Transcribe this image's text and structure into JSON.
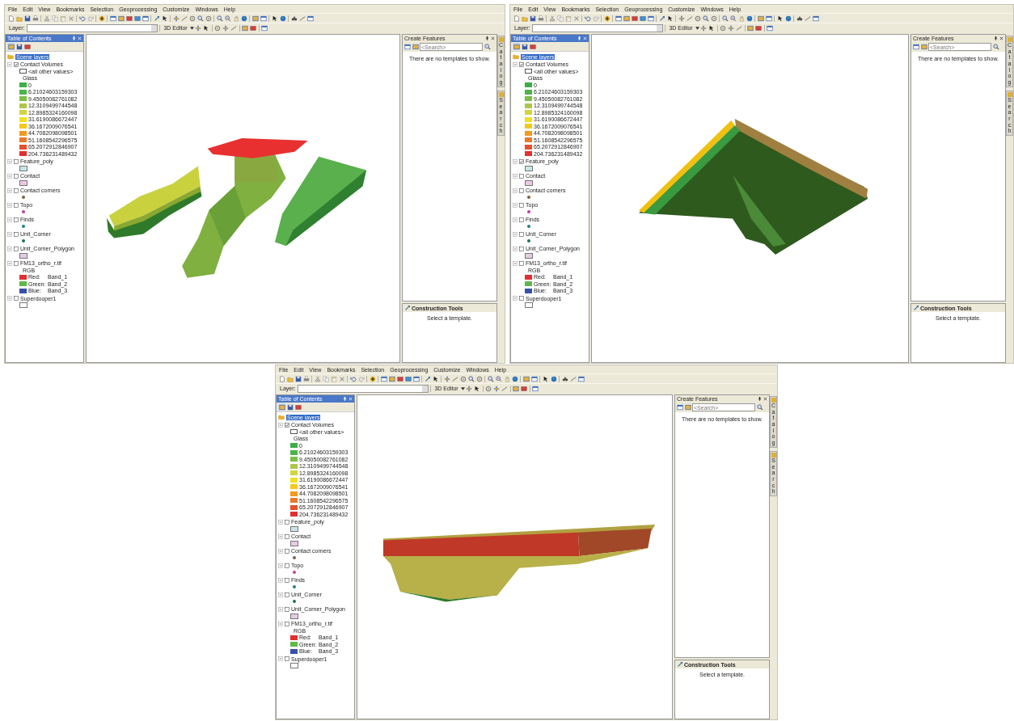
{
  "windows": [
    {
      "menu": [
        "File",
        "Edit",
        "View",
        "Bookmarks",
        "Selection",
        "Geoprocessing",
        "Customize",
        "Windows",
        "Help"
      ],
      "layer_label": "Layer:",
      "editor_button": "3D Editor",
      "right_tabs": [
        "Catalog",
        "Search"
      ],
      "toc": {
        "title": "Table of Contents",
        "root": {
          "label": "Scene layers",
          "selected": true
        },
        "layers": [
          {
            "name": "Contact Volumes",
            "checked": true,
            "expanded": true,
            "legend": [
              {
                "kind": "outline",
                "label": "<all other values>"
              },
              {
                "kind": "heading",
                "label": "Glass"
              },
              {
                "kind": "class",
                "label": "0",
                "color": "#3cae48"
              },
              {
                "kind": "class",
                "label": "6.21024603159303",
                "color": "#4cb448"
              },
              {
                "kind": "class",
                "label": "9.45050082761082",
                "color": "#7cbe48"
              },
              {
                "kind": "class",
                "label": "12.3109499744548",
                "color": "#aec54a"
              },
              {
                "kind": "class",
                "label": "12.8985324160098",
                "color": "#d2d43e"
              },
              {
                "kind": "class",
                "label": "31.6190086672447",
                "color": "#f0e020"
              },
              {
                "kind": "class",
                "label": "36.1672009076541",
                "color": "#f6c81c"
              },
              {
                "kind": "class",
                "label": "44.7082098098501",
                "color": "#f29a1e"
              },
              {
                "kind": "class",
                "label": "51.1608542296575",
                "color": "#ea7a2c"
              },
              {
                "kind": "class",
                "label": "65.2072912846907",
                "color": "#e6502e"
              },
              {
                "kind": "class",
                "label": "204.736231489432",
                "color": "#e03030"
              }
            ]
          },
          {
            "name": "Feature_poly",
            "checked": false,
            "expanded": true,
            "legend": [
              {
                "kind": "fill",
                "color": "#c8e6e6"
              }
            ]
          },
          {
            "name": "Contact",
            "checked": false,
            "expanded": true,
            "legend": [
              {
                "kind": "fill",
                "color": "#ecc8e4"
              }
            ]
          },
          {
            "name": "Contact corners",
            "checked": false,
            "expanded": true,
            "legend": [
              {
                "kind": "point",
                "color": "#806040"
              }
            ]
          },
          {
            "name": "Topo",
            "checked": false,
            "expanded": true,
            "legend": [
              {
                "kind": "point",
                "color": "#c040a0"
              }
            ]
          },
          {
            "name": "Finds",
            "checked": false,
            "expanded": true,
            "legend": [
              {
                "kind": "point",
                "color": "#208080"
              }
            ]
          },
          {
            "name": "Unit_Corner",
            "checked": false,
            "expanded": true,
            "legend": [
              {
                "kind": "point",
                "color": "#207060"
              }
            ]
          },
          {
            "name": "Unit_Corner_Polygon",
            "checked": false,
            "expanded": true,
            "legend": [
              {
                "kind": "fill",
                "color": "#e4cce4"
              }
            ]
          },
          {
            "name": "FM13_ortho_r.tif",
            "checked": false,
            "expanded": true,
            "legend": [
              {
                "kind": "heading",
                "label": "RGB"
              },
              {
                "kind": "band",
                "label": "Red:",
                "band": "Band_1",
                "color": "#e03030"
              },
              {
                "kind": "band",
                "label": "Green:",
                "band": "Band_2",
                "color": "#60b848"
              },
              {
                "kind": "band",
                "label": "Blue:",
                "band": "Band_3",
                "color": "#3850a8"
              }
            ]
          },
          {
            "name": "Superdooper1",
            "checked": false,
            "expanded": true,
            "legend": [
              {
                "kind": "fill",
                "color": "#ffffff"
              }
            ]
          }
        ]
      },
      "create_features": {
        "title": "Create Features",
        "placeholder": "<Search>",
        "message": "There are no templates to show."
      },
      "construction_tools": {
        "title": "Construction Tools",
        "message": "Select a template."
      }
    },
    {
      "menu": [
        "File",
        "Edit",
        "View",
        "Bookmarks",
        "Selection",
        "Geoprocessing",
        "Customize",
        "Windows",
        "Help"
      ],
      "layer_label": "Layer:",
      "editor_button": "3D Editor",
      "right_tabs": [
        "Catalog",
        "Search"
      ],
      "toc": {
        "title": "Table of Contents",
        "root": {
          "label": "Scene layers",
          "selected": true
        },
        "layers": [
          {
            "name": "Contact Volumes",
            "checked": true,
            "expanded": true,
            "legend": [
              {
                "kind": "outline",
                "label": "<all other values>"
              },
              {
                "kind": "heading",
                "label": "Glass"
              },
              {
                "kind": "class",
                "label": "0",
                "color": "#3cae48"
              },
              {
                "kind": "class",
                "label": "6.21024603159303",
                "color": "#4cb448"
              },
              {
                "kind": "class",
                "label": "9.45050082761082",
                "color": "#7cbe48"
              },
              {
                "kind": "class",
                "label": "12.3109499744548",
                "color": "#aec54a"
              },
              {
                "kind": "class",
                "label": "12.8985324160098",
                "color": "#d2d43e"
              },
              {
                "kind": "class",
                "label": "31.6190086672447",
                "color": "#f0e020"
              },
              {
                "kind": "class",
                "label": "36.1672009076541",
                "color": "#f6c81c"
              },
              {
                "kind": "class",
                "label": "44.7082098098501",
                "color": "#f29a1e"
              },
              {
                "kind": "class",
                "label": "51.1608542296575",
                "color": "#ea7a2c"
              },
              {
                "kind": "class",
                "label": "65.2072912846907",
                "color": "#e6502e"
              },
              {
                "kind": "class",
                "label": "204.736231489432",
                "color": "#e03030"
              }
            ]
          },
          {
            "name": "Feature_poly",
            "checked": true,
            "expanded": true,
            "legend": [
              {
                "kind": "fill",
                "color": "#c8e6e6"
              }
            ]
          },
          {
            "name": "Contact",
            "checked": false,
            "expanded": true,
            "legend": [
              {
                "kind": "fill",
                "color": "#ecc8e4"
              }
            ]
          },
          {
            "name": "Contact corners",
            "checked": false,
            "expanded": true,
            "legend": [
              {
                "kind": "point",
                "color": "#806040"
              }
            ]
          },
          {
            "name": "Topo",
            "checked": false,
            "expanded": true,
            "legend": [
              {
                "kind": "point",
                "color": "#c040a0"
              }
            ]
          },
          {
            "name": "Finds",
            "checked": false,
            "expanded": true,
            "legend": [
              {
                "kind": "point",
                "color": "#208080"
              }
            ]
          },
          {
            "name": "Unit_Corner",
            "checked": false,
            "expanded": true,
            "legend": [
              {
                "kind": "point",
                "color": "#207060"
              }
            ]
          },
          {
            "name": "Unit_Corner_Polygon",
            "checked": false,
            "expanded": true,
            "legend": [
              {
                "kind": "fill",
                "color": "#e4cce4"
              }
            ]
          },
          {
            "name": "FM13_ortho_r.tif",
            "checked": false,
            "expanded": true,
            "legend": [
              {
                "kind": "heading",
                "label": "RGB"
              },
              {
                "kind": "band",
                "label": "Red:",
                "band": "Band_1",
                "color": "#e03030"
              },
              {
                "kind": "band",
                "label": "Green:",
                "band": "Band_2",
                "color": "#60b848"
              },
              {
                "kind": "band",
                "label": "Blue:",
                "band": "Band_3",
                "color": "#3850a8"
              }
            ]
          },
          {
            "name": "Superdooper1",
            "checked": false,
            "expanded": true,
            "legend": [
              {
                "kind": "fill",
                "color": "#ffffff"
              }
            ]
          }
        ]
      },
      "create_features": {
        "title": "Create Features",
        "placeholder": "<Search>",
        "message": "There are no templates to show."
      },
      "construction_tools": {
        "title": "Construction Tools",
        "message": "Select a template."
      }
    },
    {
      "menu": [
        "File",
        "Edit",
        "View",
        "Bookmarks",
        "Selection",
        "Geoprocessing",
        "Customize",
        "Windows",
        "Help"
      ],
      "layer_label": "Layer:",
      "editor_button": "3D Editor",
      "right_tabs": [
        "Catalog",
        "Search"
      ],
      "toc": {
        "title": "Table of Contents",
        "root": {
          "label": "Scene layers",
          "selected": true
        },
        "layers": [
          {
            "name": "Contact Volumes",
            "checked": true,
            "expanded": true,
            "legend": [
              {
                "kind": "outline",
                "label": "<all other values>"
              },
              {
                "kind": "heading",
                "label": "Glass"
              },
              {
                "kind": "class",
                "label": "0",
                "color": "#3cae48"
              },
              {
                "kind": "class",
                "label": "6.21024603159303",
                "color": "#4cb448"
              },
              {
                "kind": "class",
                "label": "9.45050082761082",
                "color": "#7cbe48"
              },
              {
                "kind": "class",
                "label": "12.3109499744548",
                "color": "#aec54a"
              },
              {
                "kind": "class",
                "label": "12.8985324160098",
                "color": "#d2d43e"
              },
              {
                "kind": "class",
                "label": "31.6190086672447",
                "color": "#f0e020"
              },
              {
                "kind": "class",
                "label": "36.1672009076541",
                "color": "#f6c81c"
              },
              {
                "kind": "class",
                "label": "44.7082098098501",
                "color": "#f29a1e"
              },
              {
                "kind": "class",
                "label": "51.1608542296575",
                "color": "#ea7a2c"
              },
              {
                "kind": "class",
                "label": "65.2072912846907",
                "color": "#e6502e"
              },
              {
                "kind": "class",
                "label": "204.736231489432",
                "color": "#e03030"
              }
            ]
          },
          {
            "name": "Feature_poly",
            "checked": false,
            "expanded": true,
            "legend": [
              {
                "kind": "fill",
                "color": "#c8e6e6"
              }
            ]
          },
          {
            "name": "Contact",
            "checked": false,
            "expanded": true,
            "legend": [
              {
                "kind": "fill",
                "color": "#ecc8e4"
              }
            ]
          },
          {
            "name": "Contact corners",
            "checked": false,
            "expanded": true,
            "legend": [
              {
                "kind": "point",
                "color": "#806040"
              }
            ]
          },
          {
            "name": "Topo",
            "checked": false,
            "expanded": true,
            "legend": [
              {
                "kind": "point",
                "color": "#c040a0"
              }
            ]
          },
          {
            "name": "Finds",
            "checked": false,
            "expanded": true,
            "legend": [
              {
                "kind": "point",
                "color": "#208080"
              }
            ]
          },
          {
            "name": "Unit_Corner",
            "checked": false,
            "expanded": true,
            "legend": [
              {
                "kind": "point",
                "color": "#207060"
              }
            ]
          },
          {
            "name": "Unit_Corner_Polygon",
            "checked": false,
            "expanded": true,
            "legend": [
              {
                "kind": "fill",
                "color": "#e4cce4"
              }
            ]
          },
          {
            "name": "FM13_ortho_r.tif",
            "checked": false,
            "expanded": true,
            "legend": [
              {
                "kind": "heading",
                "label": "RGB"
              },
              {
                "kind": "band",
                "label": "Red:",
                "band": "Band_1",
                "color": "#e03030"
              },
              {
                "kind": "band",
                "label": "Green:",
                "band": "Band_2",
                "color": "#60b848"
              },
              {
                "kind": "band",
                "label": "Blue:",
                "band": "Band_3",
                "color": "#3850a8"
              }
            ]
          },
          {
            "name": "Superdooper1",
            "checked": false,
            "expanded": true,
            "legend": [
              {
                "kind": "fill",
                "color": "#ffffff"
              }
            ]
          }
        ]
      },
      "create_features": {
        "title": "Create Features",
        "placeholder": "<Search>",
        "message": "There are no templates to show."
      },
      "construction_tools": {
        "title": "Construction Tools",
        "message": "Select a template."
      }
    }
  ]
}
